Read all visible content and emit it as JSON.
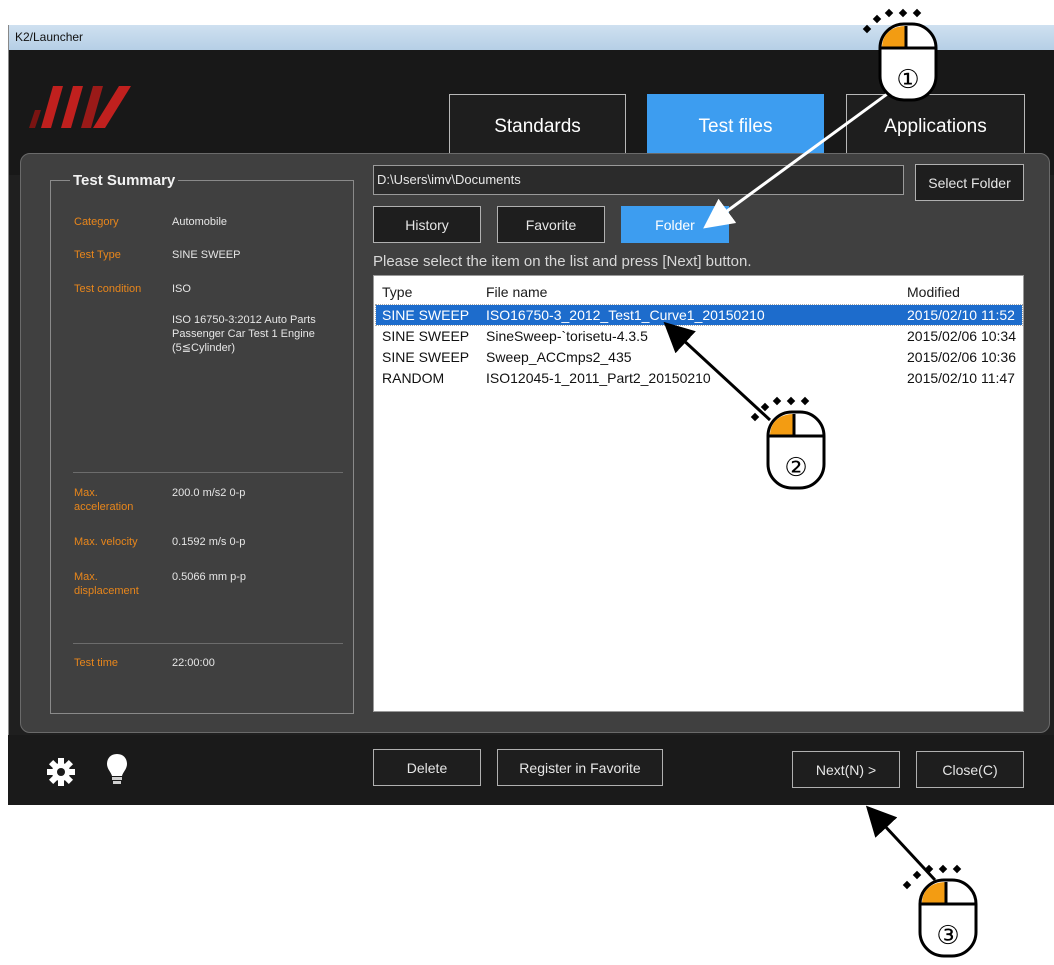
{
  "window": {
    "title": "K2/Launcher"
  },
  "header": {
    "logo_text": "IMV",
    "tabs": [
      {
        "label": "Standards",
        "active": false
      },
      {
        "label": "Test files",
        "active": true
      },
      {
        "label": "Applications",
        "active": false
      }
    ]
  },
  "summary": {
    "title": "Test Summary",
    "category_label": "Category",
    "category_value": "Automobile",
    "test_type_label": "Test Type",
    "test_type_value": "SINE SWEEP",
    "test_condition_label": "Test condition",
    "test_condition_value": "ISO",
    "test_condition_detail_1": "ISO 16750-3:2012 Auto Parts",
    "test_condition_detail_2": "Passenger Car Test 1 Engine",
    "test_condition_detail_3": "(5≦Cylinder)",
    "max_acc_label_1": "Max.",
    "max_acc_label_2": "acceleration",
    "max_acc_value": "200.0 m/s2 0-p",
    "max_vel_label": "Max. velocity",
    "max_vel_value": "0.1592 m/s 0-p",
    "max_disp_label_1": "Max.",
    "max_disp_label_2": "displacement",
    "max_disp_value": "0.5066 mm p-p",
    "test_time_label": "Test time",
    "test_time_value": "22:00:00"
  },
  "folder": {
    "path": "D:\\Users\\imv\\Documents",
    "select_folder_label": "Select Folder"
  },
  "subtabs": [
    {
      "label": "History",
      "active": false
    },
    {
      "label": "Favorite",
      "active": false
    },
    {
      "label": "Folder",
      "active": true
    }
  ],
  "instruction": "Please select the item on the list and press [Next] button.",
  "list": {
    "headers": {
      "type": "Type",
      "file_name": "File name",
      "modified": "Modified"
    },
    "rows": [
      {
        "type": "SINE SWEEP",
        "file_name": "ISO16750-3_2012_Test1_Curve1_20150210",
        "modified": "2015/02/10 11:52",
        "selected": true
      },
      {
        "type": "SINE SWEEP",
        "file_name": "SineSweep-`torisetu-4.3.5",
        "modified": "2015/02/06 10:34",
        "selected": false
      },
      {
        "type": "SINE SWEEP",
        "file_name": "Sweep_ACCmps2_435",
        "modified": "2015/02/06 10:36",
        "selected": false
      },
      {
        "type": "RANDOM",
        "file_name": "ISO12045-1_2011_Part2_20150210",
        "modified": "2015/02/10 11:47",
        "selected": false
      }
    ]
  },
  "bottom": {
    "settings_icon": "gear-icon",
    "hint_icon": "lightbulb-icon",
    "delete_label": "Delete",
    "register_label": "Register in Favorite",
    "next_label": "Next(N) >",
    "close_label": "Close(C)"
  },
  "annotations": {
    "step1": "①",
    "step2": "②",
    "step3": "③",
    "accent_color": "#f39c12"
  }
}
